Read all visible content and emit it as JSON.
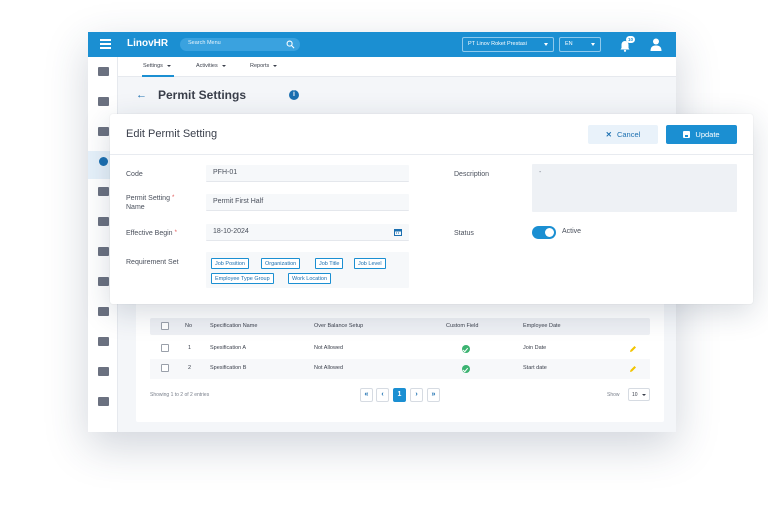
{
  "topbar": {
    "app_name_prefix": "Linov",
    "app_name_suffix": "HR",
    "search_placeholder": "Search Menu",
    "company": "PT Linov Roket Prestasi",
    "language": "EN",
    "notification_count": "10"
  },
  "subnav": {
    "tabs": [
      {
        "label": "Settings"
      },
      {
        "label": "Activities"
      },
      {
        "label": "Reports"
      }
    ]
  },
  "page": {
    "title": "Permit Settings"
  },
  "modal": {
    "title": "Edit Permit Setting",
    "cancel_label": "Cancel",
    "update_label": "Update",
    "fields": {
      "code_label": "Code",
      "code_value": "PFH-01",
      "name_label_1": "Permit Setting",
      "name_label_2": "Name",
      "name_value": "Permit First Half",
      "effective_label": "Effective Begin",
      "effective_value": "18-10-2024",
      "requirement_label": "Requirement Set",
      "description_label": "Description",
      "description_value": "-",
      "status_label": "Status",
      "status_value": "Active"
    },
    "requirements": [
      "Job Position",
      "Organization",
      "Job Title",
      "Job Level",
      "Employee Type Group",
      "Work Location"
    ]
  },
  "table": {
    "headers": [
      "No",
      "Specification Name",
      "Over Balance Setup",
      "Custom Field",
      "Employee Date"
    ],
    "rows": [
      {
        "no": "1",
        "name": "Spesification A",
        "over_balance": "Not Allowed",
        "employee_date": "Join Date"
      },
      {
        "no": "2",
        "name": "Spesification B",
        "over_balance": "Not Allowed",
        "employee_date": "Start date"
      }
    ],
    "footer": "Showing 1 to 2 of 2 entries",
    "current_page": "1",
    "show_label": "Show",
    "show_value": "10"
  },
  "colors": {
    "primary": "#1b8fd2",
    "success": "#3cb371",
    "warning": "#f2c400"
  }
}
